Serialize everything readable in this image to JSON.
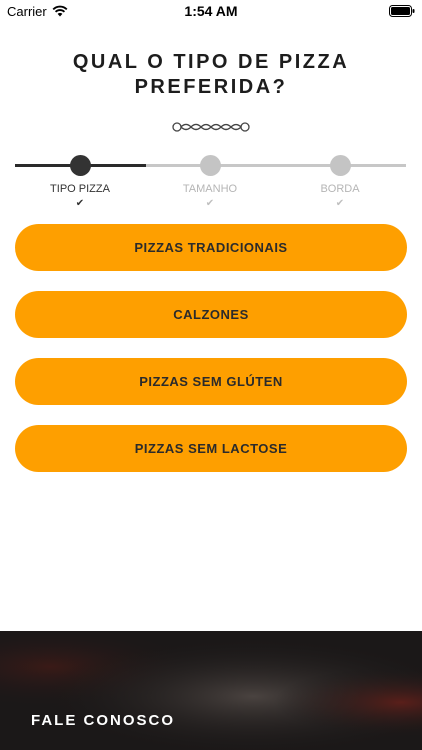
{
  "status_bar": {
    "carrier": "Carrier",
    "time": "1:54 AM",
    "icons": [
      "wifi-icon",
      "battery-icon"
    ]
  },
  "header": {
    "title_line1": "QUAL O TIPO DE PIZZA",
    "title_line2": "PREFERIDA?",
    "ornament_icon": "ornament-divider-icon"
  },
  "stepper": {
    "steps": [
      {
        "label": "TIPO PIZZA",
        "state": "active"
      },
      {
        "label": "TAMANHO",
        "state": "inactive"
      },
      {
        "label": "BORDA",
        "state": "inactive"
      }
    ],
    "check_icon": "✔",
    "colors": {
      "active": "#333333",
      "inactive": "#c4c4c4"
    }
  },
  "options": [
    {
      "label": "PIZZAS TRADICIONAIS"
    },
    {
      "label": "CALZONES"
    },
    {
      "label": "PIZZAS SEM GLÚTEN"
    },
    {
      "label": "PIZZAS SEM LACTOSE"
    }
  ],
  "footer": {
    "label": "FALE CONOSCO"
  },
  "colors": {
    "accent": "#fe9f00",
    "footer_background": "#1b1818"
  }
}
